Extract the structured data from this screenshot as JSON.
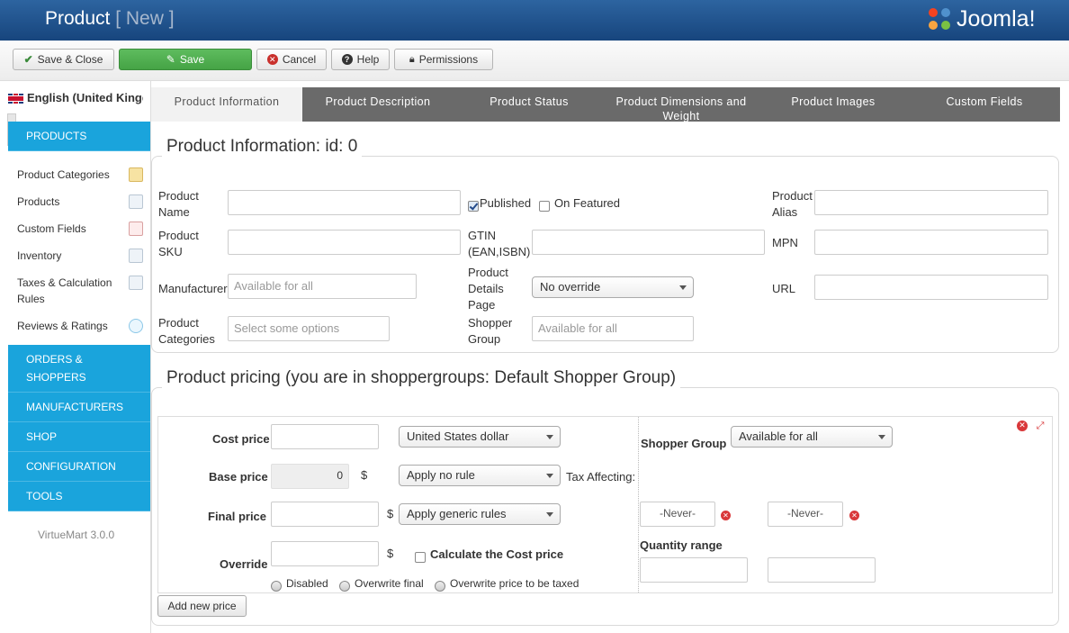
{
  "header": {
    "title": "Product",
    "subtitle": "[ New ]",
    "logo_text": "Joomla!"
  },
  "toolbar": {
    "save_close": "Save & Close",
    "save": "Save",
    "cancel": "Cancel",
    "help": "Help",
    "permissions": "Permissions"
  },
  "sidebar": {
    "language": "English (United Kingdom)",
    "products_head": "PRODUCTS",
    "items": [
      "Product Categories",
      "Products",
      "Custom Fields",
      "Inventory",
      "Taxes & Calculation Rules",
      "Reviews & Ratings"
    ],
    "sections": [
      "ORDERS & SHOPPERS",
      "MANUFACTURERS",
      "SHOP",
      "CONFIGURATION",
      "TOOLS"
    ],
    "version": "VirtueMart 3.0.0"
  },
  "tabs": [
    "Product Information",
    "Product Description",
    "Product Status",
    "Product Dimensions and Weight",
    "Product Images",
    "Custom Fields"
  ],
  "info": {
    "legend": "Product Information: id: 0",
    "product_name": "Product Name",
    "published": "Published",
    "on_featured": "On Featured",
    "product_alias": "Product Alias",
    "product_sku": "Product SKU",
    "gtin": "GTIN (EAN,ISBN)",
    "mpn": "MPN",
    "manufacturer": "Manufacturer",
    "manufacturer_placeholder": "Available for all",
    "details_page": "Product Details Page",
    "details_value": "No override",
    "url": "URL",
    "categories": "Product Categories",
    "categories_placeholder": "Select some options",
    "shopper_group": "Shopper Group",
    "shopper_group_placeholder": "Available for all"
  },
  "pricing": {
    "legend": "Product pricing (you are in shoppergroups: Default Shopper Group)",
    "cost_price": "Cost price",
    "currency": "United States dollar",
    "base_price": "Base price",
    "base_value": "0",
    "dollar": "$",
    "tax_rule": "Apply no rule",
    "tax_affecting": "Tax Affecting:",
    "final_price": "Final price",
    "discount_rule": "Apply generic rules",
    "override": "Override",
    "calc_cost": "Calculate the Cost price",
    "radio_disabled": "Disabled",
    "radio_overwrite_final": "Overwrite final",
    "radio_overwrite_taxed": "Overwrite price to be taxed",
    "shopper_group": "Shopper Group",
    "shopper_group_value": "Available for all",
    "never": "-Never-",
    "quantity_range": "Quantity range",
    "add_new_price": "Add new price"
  },
  "colors": {
    "header": "#1c4a84",
    "accent": "#1aa4dc",
    "save_green": "#4cae4c",
    "tabs": "#6a6a6a"
  }
}
